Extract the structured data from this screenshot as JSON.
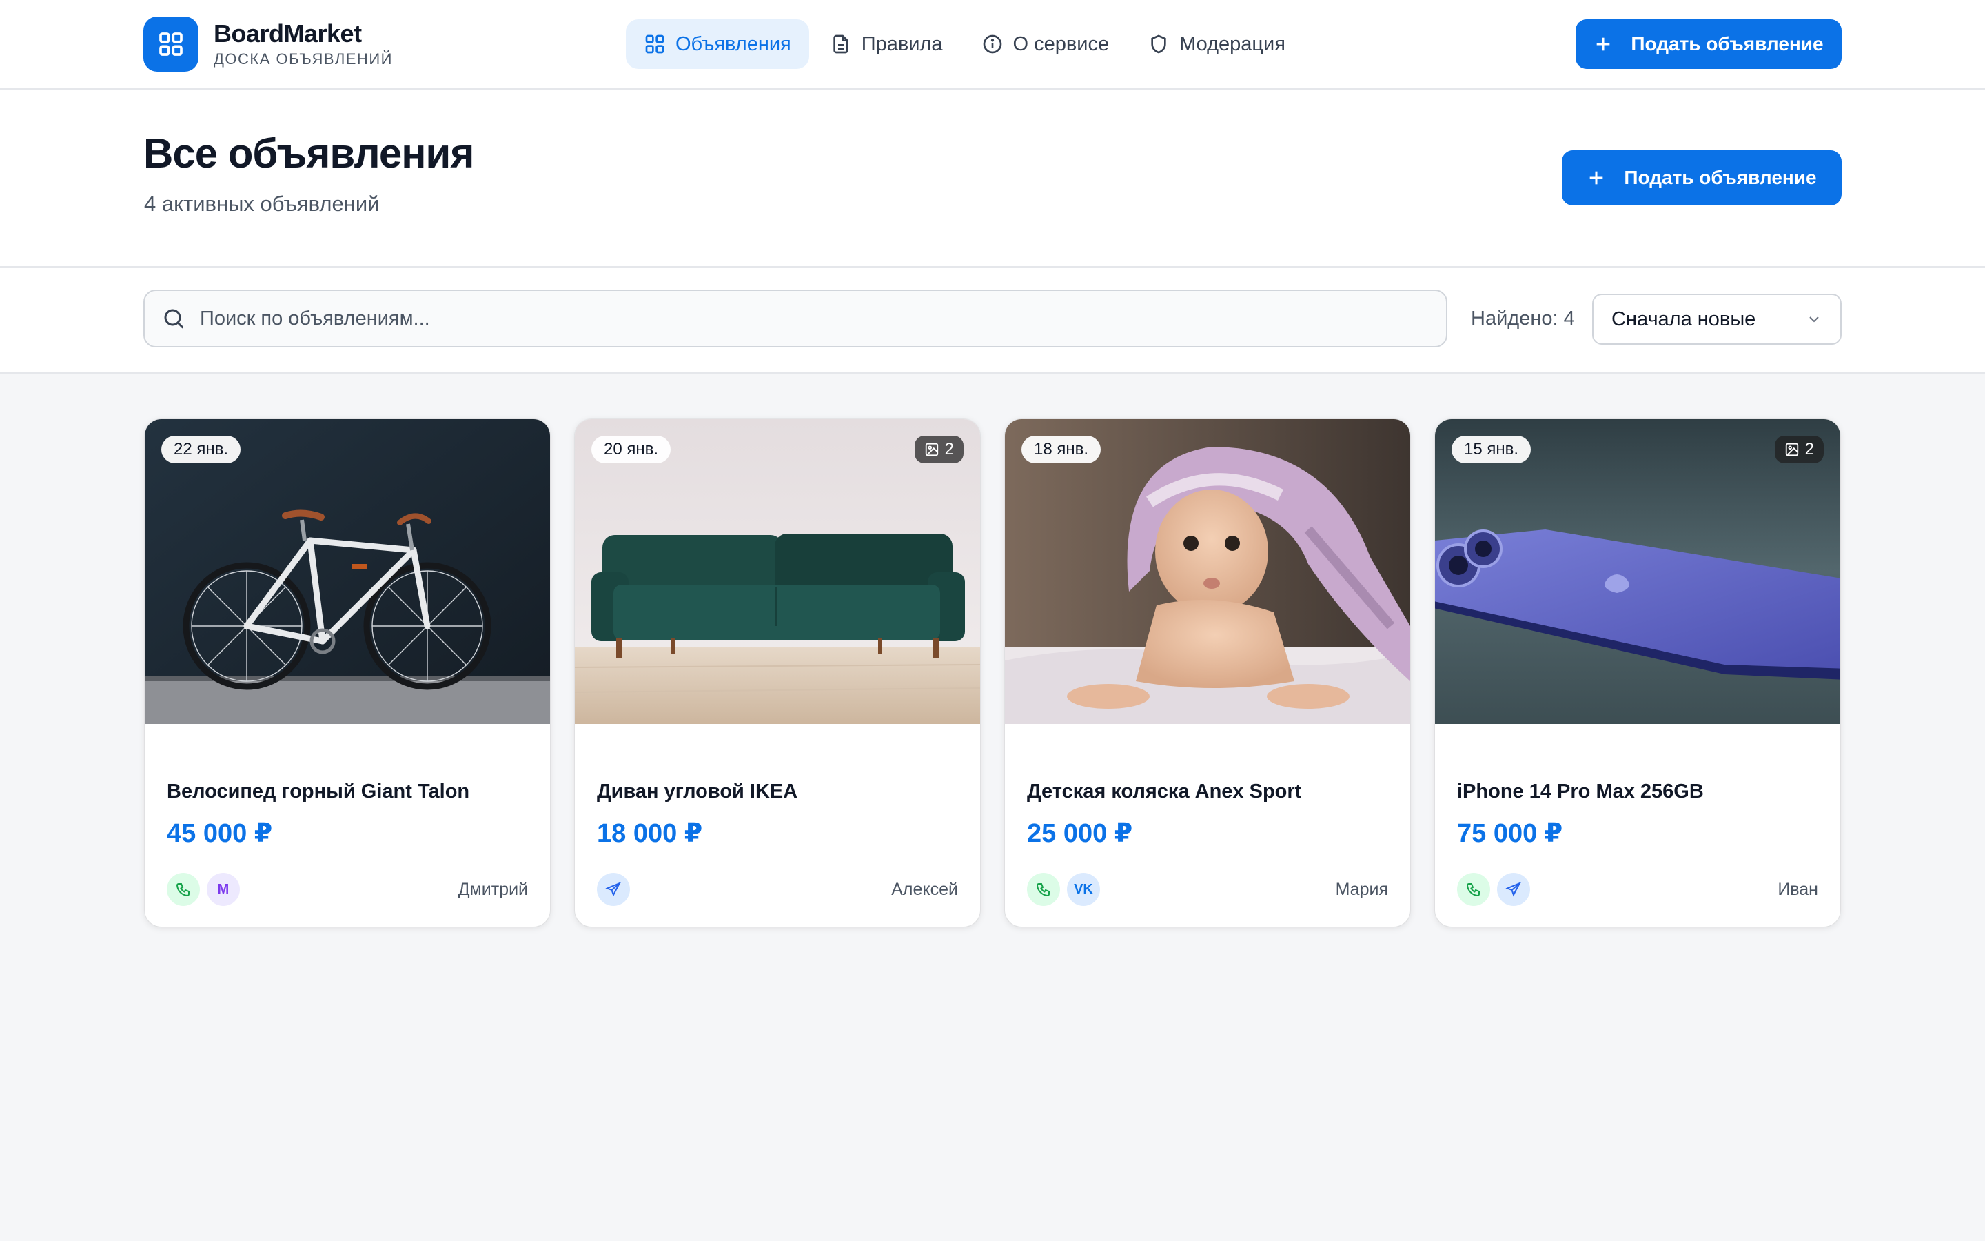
{
  "brand": {
    "name": "BoardMarket",
    "subtitle": "ДОСКА ОБЪЯВЛЕНИЙ"
  },
  "nav": {
    "items": [
      {
        "label": "Объявления",
        "icon": "grid-icon",
        "active": true
      },
      {
        "label": "Правила",
        "icon": "document-icon",
        "active": false
      },
      {
        "label": "О сервисе",
        "icon": "info-icon",
        "active": false
      },
      {
        "label": "Модерация",
        "icon": "shield-icon",
        "active": false
      }
    ],
    "cta_label": "Подать объявление"
  },
  "header": {
    "title": "Все объявления",
    "count_text": "4 активных объявлений",
    "cta_label": "Подать объявление"
  },
  "toolbar": {
    "search_placeholder": "Поиск по объявлениям...",
    "search_value": "",
    "found_text": "Найдено: 4",
    "sort_value": "Сначала новые"
  },
  "colors": {
    "accent": "#0b72e7",
    "background": "#f5f6f8",
    "card": "#ffffff"
  },
  "listings": [
    {
      "date": "22 янв.",
      "photo_count": "",
      "title": "Велосипед горный Giant Talon",
      "price": "45 000 ₽",
      "seller": "Дмитрий",
      "contacts": [
        "phone",
        "max"
      ],
      "image": "bicycle"
    },
    {
      "date": "20 янв.",
      "photo_count": "2",
      "title": "Диван угловой IKEA",
      "price": "18 000 ₽",
      "seller": "Алексей",
      "contacts": [
        "telegram"
      ],
      "image": "sofa"
    },
    {
      "date": "18 янв.",
      "photo_count": "",
      "title": "Детская коляска Anex Sport",
      "price": "25 000 ₽",
      "seller": "Мария",
      "contacts": [
        "phone",
        "vk"
      ],
      "image": "baby"
    },
    {
      "date": "15 янв.",
      "photo_count": "2",
      "title": "iPhone 14 Pro Max 256GB",
      "price": "75 000 ₽",
      "seller": "Иван",
      "contacts": [
        "phone",
        "telegram"
      ],
      "image": "phone"
    }
  ],
  "contact_labels": {
    "max": "M",
    "vk": "VK"
  }
}
